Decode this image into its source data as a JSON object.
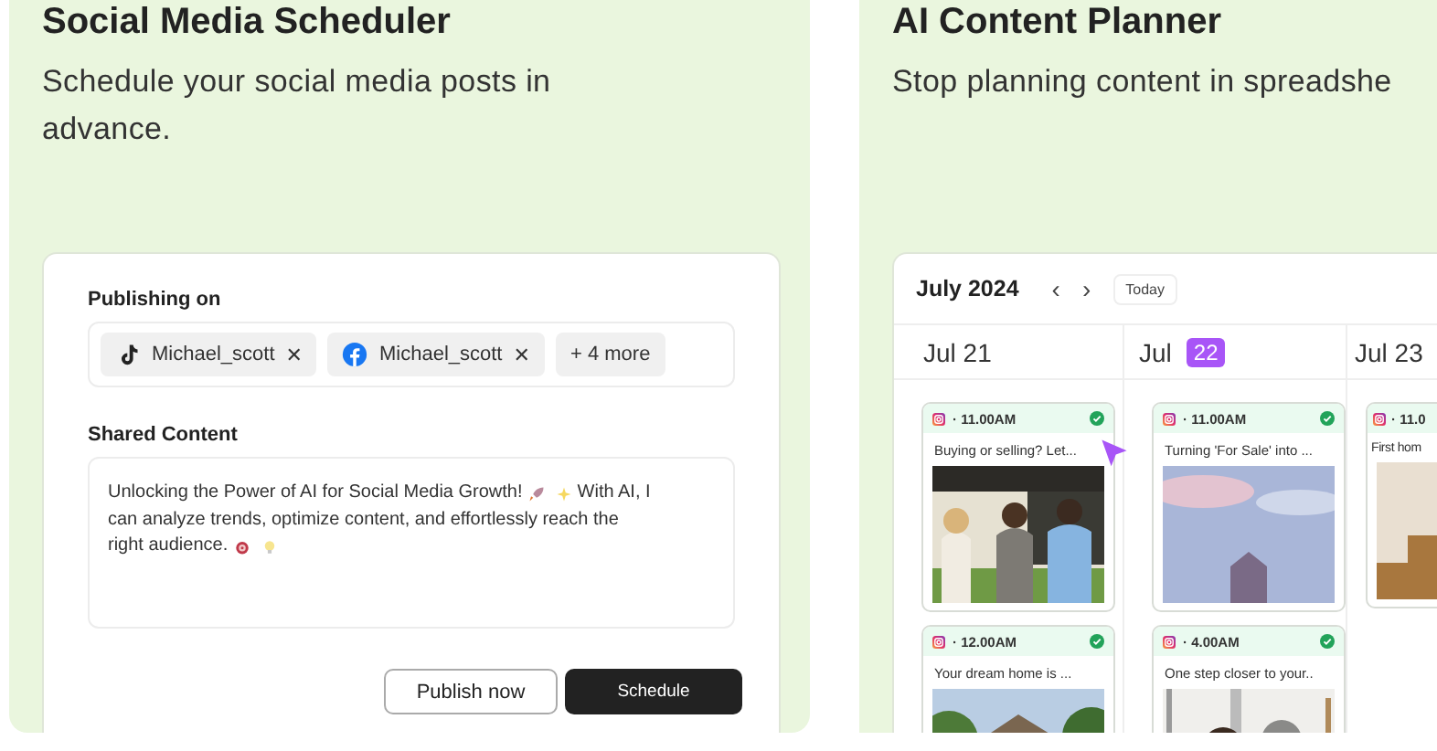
{
  "cards": [
    {
      "title": "Social Media Scheduler",
      "subtitle": "Schedule your social media posts in advance.",
      "kind": "composer"
    },
    {
      "title": "AI Content Planner",
      "subtitle": "Stop planning content in spreadshe",
      "kind": "calendar"
    }
  ],
  "composer": {
    "publishing_label": "Publishing on",
    "chips": [
      {
        "kind": "tiktok",
        "label": "Michael_scott",
        "remove": "✕"
      },
      {
        "kind": "facebook",
        "label": "Michael_scott",
        "remove": "✕"
      },
      {
        "kind": "more",
        "label": "+ 4 more"
      }
    ],
    "content_label": "Shared Content",
    "content": [
      "Unlocking the Power of AI for Social Media Growth!",
      "With AI, I",
      "can analyze trends, optimize content, and effortlessly reach the",
      "right audience."
    ],
    "buttons": [
      {
        "label": "Publish now",
        "kind": "secondary"
      },
      {
        "label": "Schedule",
        "kind": "primary"
      }
    ]
  },
  "calendar": {
    "month": "July 2024",
    "prev": "‹",
    "next": "›",
    "today": "Today",
    "days": [
      {
        "month": "Jul",
        "date": "21",
        "selected": false,
        "posts": [
          {
            "time": "· 11.00AM",
            "caption": "Buying or selling? Let...",
            "published": true
          },
          {
            "time": "· 12.00AM",
            "caption": "Your dream home is ...",
            "published": true
          }
        ]
      },
      {
        "month": "Jul",
        "date": "22",
        "selected": true,
        "posts": [
          {
            "time": "· 11.00AM",
            "caption": "Turning 'For Sale' into ...",
            "published": true
          },
          {
            "time": "· 4.00AM",
            "caption": "One step closer to your..",
            "published": true
          }
        ]
      },
      {
        "month": "Jul",
        "date": "23",
        "selected": false,
        "posts": [
          {
            "time": "· 11.0",
            "caption": "First hom"
          }
        ]
      }
    ]
  }
}
